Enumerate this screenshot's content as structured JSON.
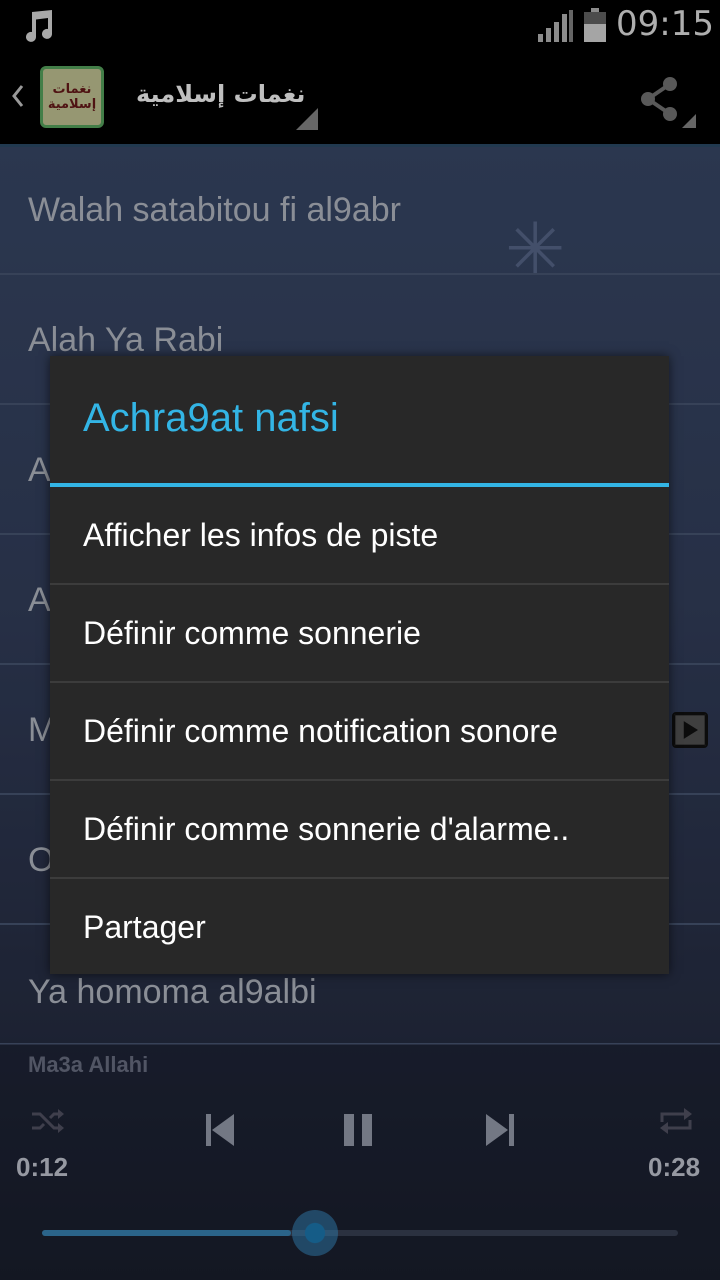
{
  "status_bar": {
    "time": "09:15"
  },
  "action_bar": {
    "app_title": "نغمات إسلامية",
    "logo_text": "نغمات إسلامية"
  },
  "list": {
    "items": [
      {
        "label": "Walah satabitou fi al9abr"
      },
      {
        "label": "Alah Ya Rabi"
      },
      {
        "label": "A"
      },
      {
        "label": "A"
      },
      {
        "label": "M"
      },
      {
        "label": "O"
      },
      {
        "label": "Ya homoma al9albi"
      }
    ]
  },
  "player": {
    "now_playing": "Ma3a Allahi",
    "elapsed": "0:12",
    "duration": "0:28",
    "progress_fraction": 0.43
  },
  "dialog": {
    "title": "Achra9at nafsi",
    "items": [
      {
        "label": "Afficher les infos de piste"
      },
      {
        "label": "Définir comme sonnerie"
      },
      {
        "label": "Définir comme notification sonore"
      },
      {
        "label": "Définir comme sonnerie d'alarme.."
      },
      {
        "label": "Partager"
      }
    ]
  },
  "colors": {
    "accent": "#33b5e5",
    "dialog_bg": "#282828"
  },
  "icons": [
    "music-note-icon",
    "signal-icon",
    "battery-icon",
    "up-chevron-icon",
    "share-icon",
    "shuffle-icon",
    "previous-icon",
    "pause-icon",
    "next-icon",
    "repeat-icon",
    "play-icon"
  ]
}
